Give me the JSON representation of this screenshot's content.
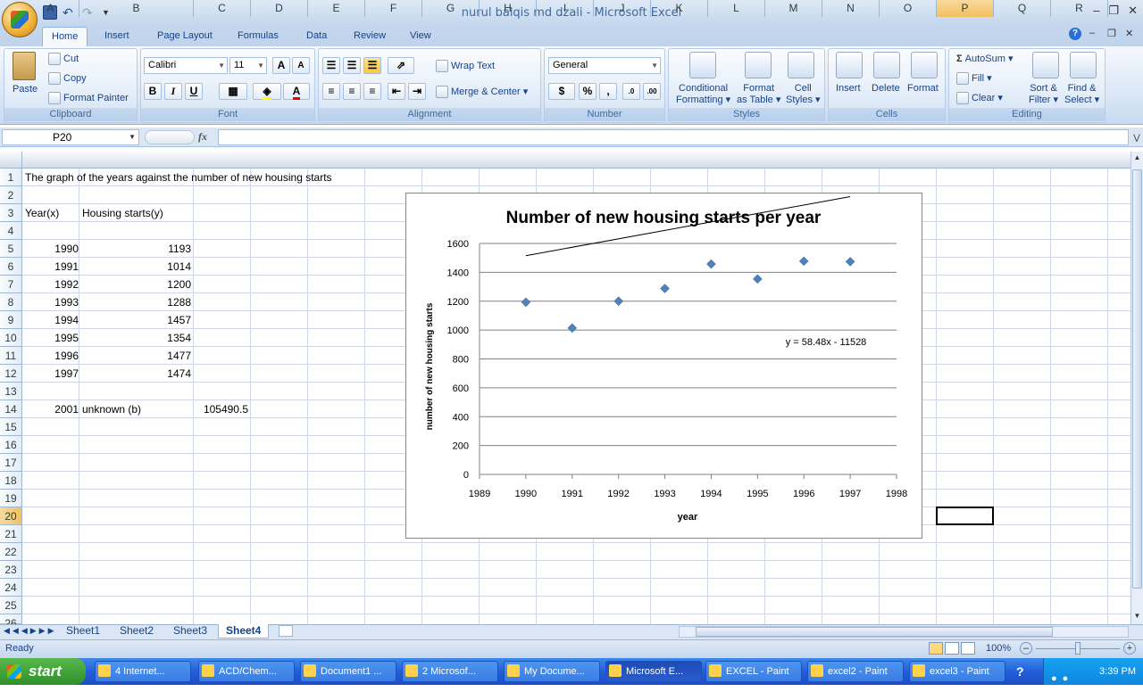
{
  "window": {
    "title": "nurul balqis md dzali - Microsoft Excel"
  },
  "tabs": [
    "Home",
    "Insert",
    "Page Layout",
    "Formulas",
    "Data",
    "Review",
    "View"
  ],
  "ribbon": {
    "clipboard": {
      "label": "Clipboard",
      "paste": "Paste",
      "cut": "Cut",
      "copy": "Copy",
      "format_painter": "Format Painter"
    },
    "font": {
      "label": "Font",
      "name": "Calibri",
      "size": "11",
      "bold": "B",
      "italic": "I",
      "underline": "U"
    },
    "alignment": {
      "label": "Alignment",
      "wrap": "Wrap Text",
      "merge": "Merge & Center"
    },
    "number": {
      "label": "Number",
      "format": "General",
      "currency": "$",
      "percent": "%",
      "comma": ","
    },
    "styles": {
      "label": "Styles",
      "conditional": "Conditional",
      "formatting": "Formatting",
      "format_as": "Format",
      "as_table": "as Table",
      "cell": "Cell",
      "cell_styles": "Styles"
    },
    "cells": {
      "label": "Cells",
      "insert": "Insert",
      "delete": "Delete",
      "format": "Format"
    },
    "editing": {
      "label": "Editing",
      "autosum": "AutoSum",
      "fill": "Fill",
      "clear": "Clear",
      "sort": "Sort &",
      "filter": "Filter",
      "find": "Find &",
      "select": "Select"
    }
  },
  "formula_bar": {
    "namebox": "P20",
    "fx": "fx",
    "value": ""
  },
  "columns": [
    "A",
    "B",
    "C",
    "D",
    "E",
    "F",
    "G",
    "H",
    "I",
    "J",
    "K",
    "L",
    "M",
    "N",
    "O",
    "P",
    "Q",
    "R"
  ],
  "rows": [
    "1",
    "2",
    "3",
    "4",
    "5",
    "6",
    "7",
    "8",
    "9",
    "10",
    "11",
    "12",
    "13",
    "14",
    "15",
    "16",
    "17",
    "18",
    "19",
    "20",
    "21",
    "22",
    "23",
    "24",
    "25",
    "26"
  ],
  "cells": {
    "A1": "The graph of the years against the number of new housing starts",
    "A3": "Year(x)",
    "B3": "Housing starts(y)",
    "data": [
      {
        "year": "1990",
        "value": "1193"
      },
      {
        "year": "1991",
        "value": "1014"
      },
      {
        "year": "1992",
        "value": "1200"
      },
      {
        "year": "1993",
        "value": "1288"
      },
      {
        "year": "1994",
        "value": "1457"
      },
      {
        "year": "1995",
        "value": "1354"
      },
      {
        "year": "1996",
        "value": "1477"
      },
      {
        "year": "1997",
        "value": "1474"
      }
    ],
    "A14": "2001",
    "B14": "unknown (b)",
    "C14": "105490.5"
  },
  "chart_data": {
    "type": "scatter",
    "title": "Number of new housing starts per year",
    "xlabel": "year",
    "ylabel": "number of new housing starts",
    "x": [
      1990,
      1991,
      1992,
      1993,
      1994,
      1995,
      1996,
      1997
    ],
    "y": [
      1193,
      1014,
      1200,
      1288,
      1457,
      1354,
      1477,
      1474
    ],
    "xlim": [
      1989,
      1998
    ],
    "ylim": [
      0,
      1600
    ],
    "xticks": [
      "1989",
      "1990",
      "1991",
      "1992",
      "1993",
      "1994",
      "1995",
      "1996",
      "1997",
      "1998"
    ],
    "yticks": [
      "0",
      "200",
      "400",
      "600",
      "800",
      "1000",
      "1200",
      "1400",
      "1600"
    ],
    "trendline": {
      "slope": 58.48,
      "intercept": -114860,
      "from": 1990,
      "to": 1997,
      "label": "y = 58.48x - 11528"
    },
    "grid": true,
    "marker_color": "#4f81bd"
  },
  "sheets": [
    "Sheet1",
    "Sheet2",
    "Sheet3",
    "Sheet4"
  ],
  "active_sheet": "Sheet4",
  "status": {
    "text": "Ready",
    "zoom": "100%"
  },
  "taskbar": {
    "start": "start",
    "items": [
      "4 Internet...",
      "ACD/Chem...",
      "Document1 ...",
      "2 Microsof...",
      "My Docume...",
      "Microsoft E...",
      "EXCEL - Paint",
      "excel2 - Paint",
      "excel3 - Paint"
    ],
    "clock": "3:39 PM"
  }
}
